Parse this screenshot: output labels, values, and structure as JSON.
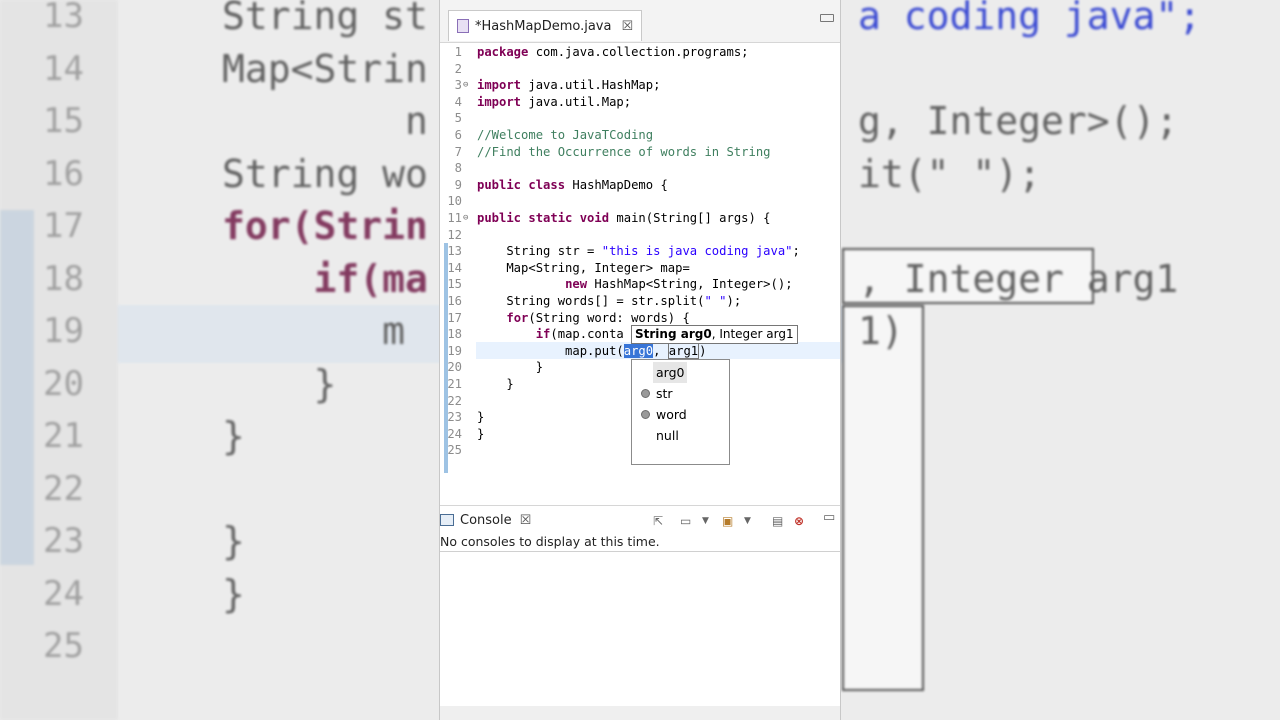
{
  "window": {
    "tab_title": "*HashMapDemo.java",
    "tab_close": "☒"
  },
  "editor": {
    "lines": [
      {
        "n": "1",
        "html": "<span class=\"kw\">package</span> com.java.collection.programs;"
      },
      {
        "n": "2",
        "html": ""
      },
      {
        "n": "3",
        "fold": "⊖",
        "html": "<span class=\"kw\">import</span> java.util.HashMap;"
      },
      {
        "n": "4",
        "html": "<span class=\"kw\">import</span> java.util.Map;"
      },
      {
        "n": "5",
        "html": ""
      },
      {
        "n": "6",
        "html": "<span class=\"cm\">//Welcome to JavaTCoding</span>"
      },
      {
        "n": "7",
        "html": "<span class=\"cm\">//Find the Occurrence of words in String</span>"
      },
      {
        "n": "8",
        "html": ""
      },
      {
        "n": "9",
        "html": "<span class=\"kw\">public class</span> HashMapDemo {"
      },
      {
        "n": "10",
        "html": ""
      },
      {
        "n": "11",
        "fold": "⊖",
        "html": "<span class=\"kw\">public static void</span> main(String[] args) {"
      },
      {
        "n": "12",
        "html": ""
      },
      {
        "n": "13",
        "html": "    String str = <span class=\"str\">\"this is java coding java\"</span>;"
      },
      {
        "n": "14",
        "html": "    Map&lt;String, Integer&gt; map="
      },
      {
        "n": "15",
        "html": "            <span class=\"kw\">new</span> HashMap&lt;String, Integer&gt;();"
      },
      {
        "n": "16",
        "html": "    String words[] = str.split(<span class=\"str\">\" \"</span>);"
      },
      {
        "n": "17",
        "html": "    <span class=\"kw\">for</span>(String word: words) {"
      },
      {
        "n": "18",
        "html": "        <span class=\"kw\">if</span>(map.conta"
      },
      {
        "n": "19",
        "current": true,
        "html": "            map.put(<span class=\"arg-sel\">arg0</span>, <span class=\"arg-box\">arg1</span>)"
      },
      {
        "n": "20",
        "html": "        }"
      },
      {
        "n": "21",
        "html": "    }"
      },
      {
        "n": "22",
        "html": ""
      },
      {
        "n": "23",
        "html": "}"
      },
      {
        "n": "24",
        "html": "}"
      },
      {
        "n": "25",
        "html": ""
      }
    ]
  },
  "tooltip": {
    "bold": "String arg0",
    "rest": ", Integer arg1"
  },
  "proposals": [
    {
      "label": "arg0",
      "selected": true,
      "icon": false
    },
    {
      "label": "str",
      "selected": false,
      "icon": true
    },
    {
      "label": "word",
      "selected": false,
      "icon": true
    },
    {
      "label": "null",
      "selected": false,
      "icon": false
    }
  ],
  "console": {
    "tab_label": "Console",
    "tab_close": "☒",
    "message": "No consoles to display at this time."
  },
  "background": {
    "lines": [
      {
        "n": "13",
        "code": "String st",
        "parts": "",
        "tail": "a coding java\";"
      },
      {
        "n": "14",
        "code": "Map<Strin",
        "tail": ""
      },
      {
        "n": "15",
        "code": "        n",
        "tail": "g, Integer>();"
      },
      {
        "n": "16",
        "code": "String wo",
        "tail": "it(\" \");"
      },
      {
        "n": "17",
        "code": "for(Strin",
        "tail": ""
      },
      {
        "n": "18",
        "code": "    if(ma",
        "tail": ", Integer arg1"
      },
      {
        "n": "19",
        "code": "       m",
        "tail": "1)"
      },
      {
        "n": "20",
        "code": "    }",
        "tail": ""
      },
      {
        "n": "21",
        "code": "}",
        "tail": ""
      },
      {
        "n": "22",
        "code": "",
        "tail": ""
      },
      {
        "n": "23",
        "code": "}",
        "tail": ""
      },
      {
        "n": "24",
        "code": "}",
        "tail": ""
      },
      {
        "n": "25",
        "code": "",
        "tail": ""
      }
    ]
  }
}
